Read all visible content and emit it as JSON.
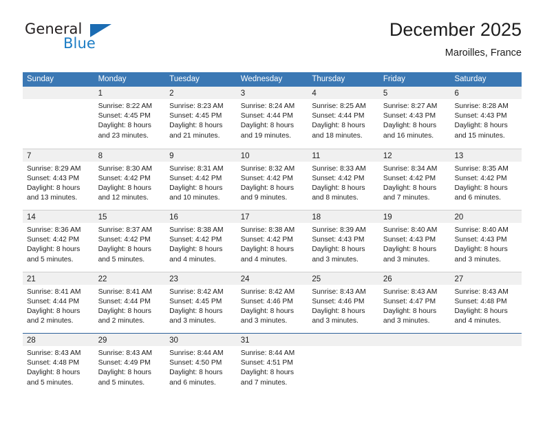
{
  "brand": {
    "name_top": "General",
    "name_bottom": "Blue",
    "triangle_color": "#1b6cb3",
    "blue_text_color": "#1b7cc4"
  },
  "header": {
    "title": "December 2025",
    "subtitle": "Maroilles, France"
  },
  "theme": {
    "header_bar_color": "#3b78b4",
    "day_band_color": "#f0f0f0",
    "grid_line_color": "#cfcfcf",
    "accent_line_color": "#2a6099"
  },
  "weekdays": [
    "Sunday",
    "Monday",
    "Tuesday",
    "Wednesday",
    "Thursday",
    "Friday",
    "Saturday"
  ],
  "weeks": [
    [
      {
        "day": "",
        "lines": [
          "",
          "",
          "",
          ""
        ]
      },
      {
        "day": "1",
        "lines": [
          "Sunrise: 8:22 AM",
          "Sunset: 4:45 PM",
          "Daylight: 8 hours",
          "and 23 minutes."
        ]
      },
      {
        "day": "2",
        "lines": [
          "Sunrise: 8:23 AM",
          "Sunset: 4:45 PM",
          "Daylight: 8 hours",
          "and 21 minutes."
        ]
      },
      {
        "day": "3",
        "lines": [
          "Sunrise: 8:24 AM",
          "Sunset: 4:44 PM",
          "Daylight: 8 hours",
          "and 19 minutes."
        ]
      },
      {
        "day": "4",
        "lines": [
          "Sunrise: 8:25 AM",
          "Sunset: 4:44 PM",
          "Daylight: 8 hours",
          "and 18 minutes."
        ]
      },
      {
        "day": "5",
        "lines": [
          "Sunrise: 8:27 AM",
          "Sunset: 4:43 PM",
          "Daylight: 8 hours",
          "and 16 minutes."
        ]
      },
      {
        "day": "6",
        "lines": [
          "Sunrise: 8:28 AM",
          "Sunset: 4:43 PM",
          "Daylight: 8 hours",
          "and 15 minutes."
        ]
      }
    ],
    [
      {
        "day": "7",
        "lines": [
          "Sunrise: 8:29 AM",
          "Sunset: 4:43 PM",
          "Daylight: 8 hours",
          "and 13 minutes."
        ]
      },
      {
        "day": "8",
        "lines": [
          "Sunrise: 8:30 AM",
          "Sunset: 4:42 PM",
          "Daylight: 8 hours",
          "and 12 minutes."
        ]
      },
      {
        "day": "9",
        "lines": [
          "Sunrise: 8:31 AM",
          "Sunset: 4:42 PM",
          "Daylight: 8 hours",
          "and 10 minutes."
        ]
      },
      {
        "day": "10",
        "lines": [
          "Sunrise: 8:32 AM",
          "Sunset: 4:42 PM",
          "Daylight: 8 hours",
          "and 9 minutes."
        ]
      },
      {
        "day": "11",
        "lines": [
          "Sunrise: 8:33 AM",
          "Sunset: 4:42 PM",
          "Daylight: 8 hours",
          "and 8 minutes."
        ]
      },
      {
        "day": "12",
        "lines": [
          "Sunrise: 8:34 AM",
          "Sunset: 4:42 PM",
          "Daylight: 8 hours",
          "and 7 minutes."
        ]
      },
      {
        "day": "13",
        "lines": [
          "Sunrise: 8:35 AM",
          "Sunset: 4:42 PM",
          "Daylight: 8 hours",
          "and 6 minutes."
        ]
      }
    ],
    [
      {
        "day": "14",
        "lines": [
          "Sunrise: 8:36 AM",
          "Sunset: 4:42 PM",
          "Daylight: 8 hours",
          "and 5 minutes."
        ]
      },
      {
        "day": "15",
        "lines": [
          "Sunrise: 8:37 AM",
          "Sunset: 4:42 PM",
          "Daylight: 8 hours",
          "and 5 minutes."
        ]
      },
      {
        "day": "16",
        "lines": [
          "Sunrise: 8:38 AM",
          "Sunset: 4:42 PM",
          "Daylight: 8 hours",
          "and 4 minutes."
        ]
      },
      {
        "day": "17",
        "lines": [
          "Sunrise: 8:38 AM",
          "Sunset: 4:42 PM",
          "Daylight: 8 hours",
          "and 4 minutes."
        ]
      },
      {
        "day": "18",
        "lines": [
          "Sunrise: 8:39 AM",
          "Sunset: 4:43 PM",
          "Daylight: 8 hours",
          "and 3 minutes."
        ]
      },
      {
        "day": "19",
        "lines": [
          "Sunrise: 8:40 AM",
          "Sunset: 4:43 PM",
          "Daylight: 8 hours",
          "and 3 minutes."
        ]
      },
      {
        "day": "20",
        "lines": [
          "Sunrise: 8:40 AM",
          "Sunset: 4:43 PM",
          "Daylight: 8 hours",
          "and 3 minutes."
        ]
      }
    ],
    [
      {
        "day": "21",
        "lines": [
          "Sunrise: 8:41 AM",
          "Sunset: 4:44 PM",
          "Daylight: 8 hours",
          "and 2 minutes."
        ]
      },
      {
        "day": "22",
        "lines": [
          "Sunrise: 8:41 AM",
          "Sunset: 4:44 PM",
          "Daylight: 8 hours",
          "and 2 minutes."
        ]
      },
      {
        "day": "23",
        "lines": [
          "Sunrise: 8:42 AM",
          "Sunset: 4:45 PM",
          "Daylight: 8 hours",
          "and 3 minutes."
        ]
      },
      {
        "day": "24",
        "lines": [
          "Sunrise: 8:42 AM",
          "Sunset: 4:46 PM",
          "Daylight: 8 hours",
          "and 3 minutes."
        ]
      },
      {
        "day": "25",
        "lines": [
          "Sunrise: 8:43 AM",
          "Sunset: 4:46 PM",
          "Daylight: 8 hours",
          "and 3 minutes."
        ]
      },
      {
        "day": "26",
        "lines": [
          "Sunrise: 8:43 AM",
          "Sunset: 4:47 PM",
          "Daylight: 8 hours",
          "and 3 minutes."
        ]
      },
      {
        "day": "27",
        "lines": [
          "Sunrise: 8:43 AM",
          "Sunset: 4:48 PM",
          "Daylight: 8 hours",
          "and 4 minutes."
        ]
      }
    ],
    [
      {
        "day": "28",
        "lines": [
          "Sunrise: 8:43 AM",
          "Sunset: 4:48 PM",
          "Daylight: 8 hours",
          "and 5 minutes."
        ]
      },
      {
        "day": "29",
        "lines": [
          "Sunrise: 8:43 AM",
          "Sunset: 4:49 PM",
          "Daylight: 8 hours",
          "and 5 minutes."
        ]
      },
      {
        "day": "30",
        "lines": [
          "Sunrise: 8:44 AM",
          "Sunset: 4:50 PM",
          "Daylight: 8 hours",
          "and 6 minutes."
        ]
      },
      {
        "day": "31",
        "lines": [
          "Sunrise: 8:44 AM",
          "Sunset: 4:51 PM",
          "Daylight: 8 hours",
          "and 7 minutes."
        ]
      },
      {
        "day": "",
        "lines": [
          "",
          "",
          "",
          ""
        ]
      },
      {
        "day": "",
        "lines": [
          "",
          "",
          "",
          ""
        ]
      },
      {
        "day": "",
        "lines": [
          "",
          "",
          "",
          ""
        ]
      }
    ]
  ]
}
